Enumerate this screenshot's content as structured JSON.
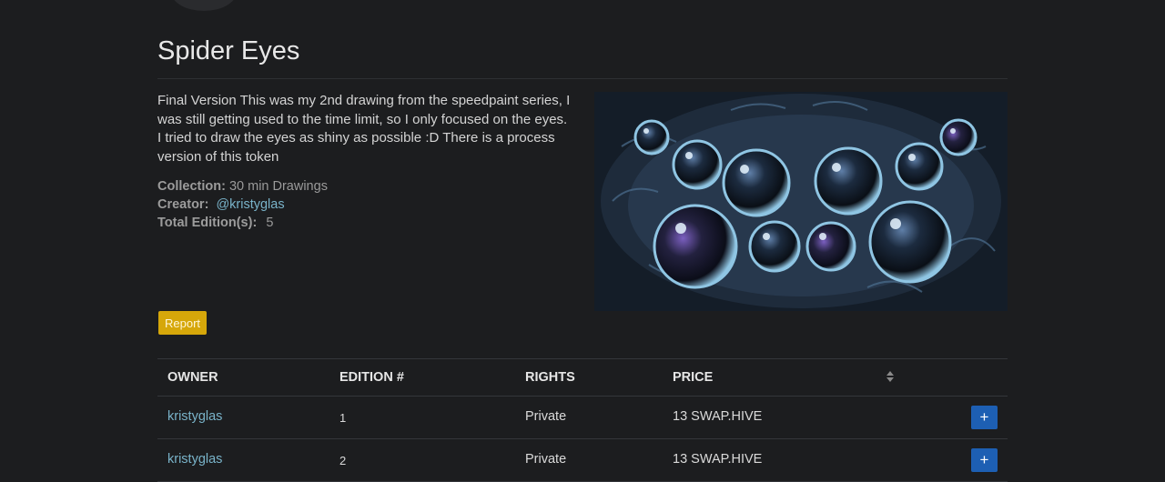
{
  "nft": {
    "title": "Spider Eyes",
    "description": "Final Version This was my 2nd drawing from the speedpaint series, I was still getting used to the time limit, so I only focused on the eyes. I tried to draw the eyes as shiny as possible :D There is a process version of this token",
    "collection_label": "Collection:",
    "collection_value": "30 min Drawings",
    "creator_label": "Creator:",
    "creator_value": "@kristyglas",
    "editions_label": "Total Edition(s):",
    "editions_value": "5",
    "report_label": "Report"
  },
  "table": {
    "headers": [
      "OWNER",
      "EDITION #",
      "RIGHTS",
      "PRICE"
    ],
    "sort_icon": "sort-icon",
    "add_icon": "+",
    "rows": [
      {
        "owner": "kristyglas",
        "edition": "1",
        "rights": "Private",
        "price": "13 SWAP.HIVE"
      },
      {
        "owner": "kristyglas",
        "edition": "2",
        "rights": "Private",
        "price": "13 SWAP.HIVE"
      }
    ]
  },
  "colors": {
    "background": "#1c1d1f",
    "link": "#79b3c9",
    "report_button": "#d6a70a",
    "add_button": "#1d5fb3"
  }
}
